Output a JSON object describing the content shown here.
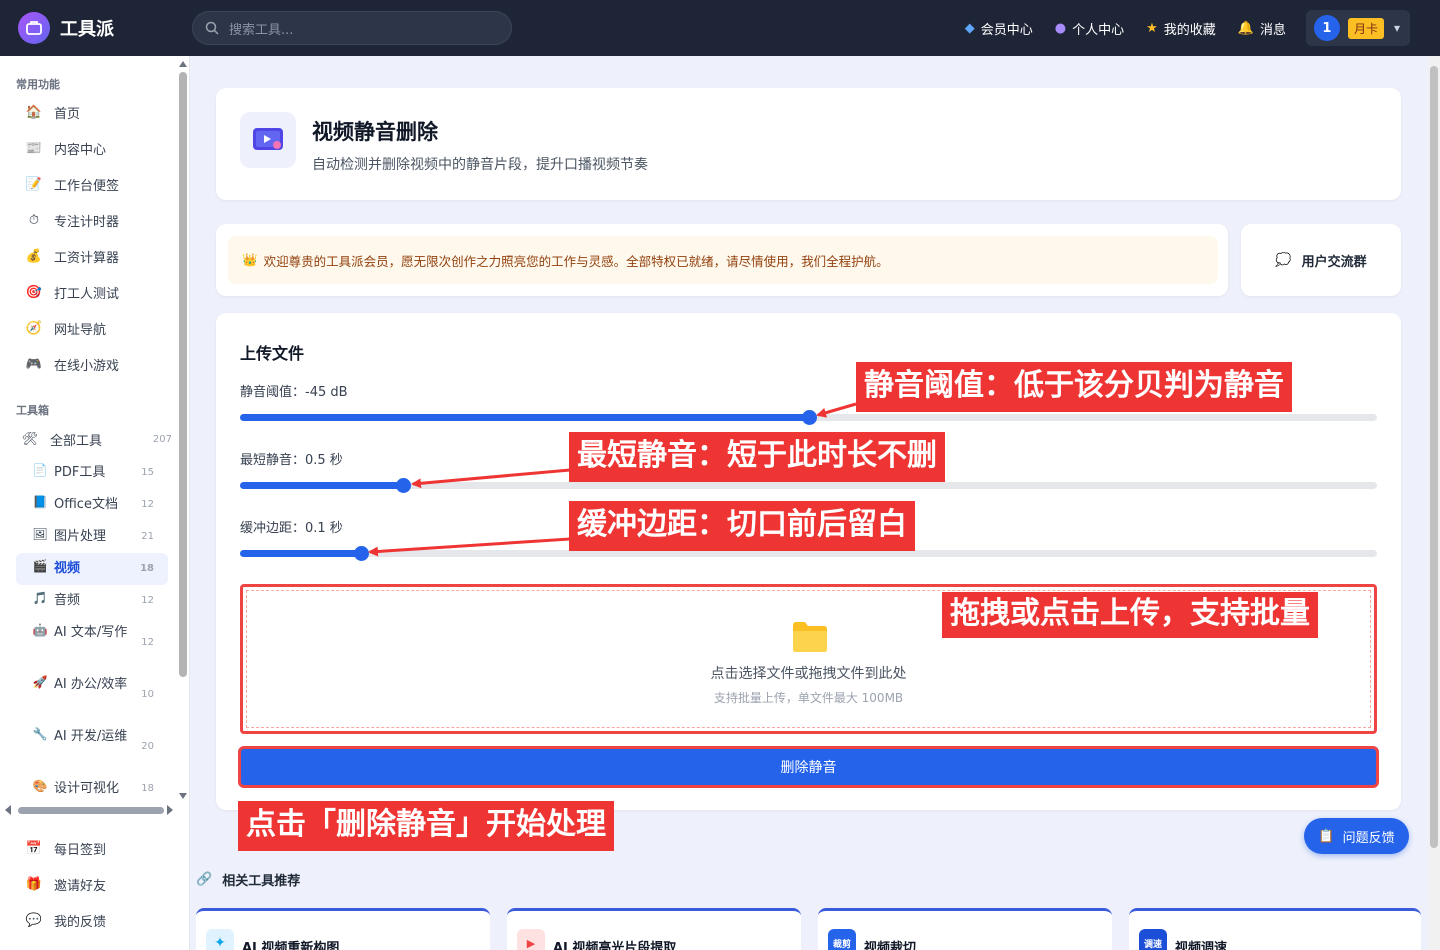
{
  "app": {
    "name": "工具派"
  },
  "search": {
    "placeholder": "搜索工具..."
  },
  "topnav": {
    "vip": "会员中心",
    "profile": "个人中心",
    "favorites": "我的收藏",
    "messages": "消息",
    "user_initial": "1",
    "membership_badge": "月卡"
  },
  "sidebar": {
    "section_common": "常用功能",
    "common_items": [
      {
        "label": "首页",
        "icon": "house-icon"
      },
      {
        "label": "内容中心",
        "icon": "newspaper-icon"
      },
      {
        "label": "工作台便签",
        "icon": "memo-icon"
      },
      {
        "label": "专注计时器",
        "icon": "stopwatch-icon"
      },
      {
        "label": "工资计算器",
        "icon": "money-bag-icon"
      },
      {
        "label": "打工人测试",
        "icon": "target-icon"
      },
      {
        "label": "网址导航",
        "icon": "compass-icon"
      },
      {
        "label": "在线小游戏",
        "icon": "gamepad-icon"
      }
    ],
    "section_tools": "工具箱",
    "all_tools": {
      "label": "全部工具",
      "count": "207"
    },
    "sub_items": [
      {
        "label": "PDF工具",
        "count": "15"
      },
      {
        "label": "Office文档",
        "count": "12"
      },
      {
        "label": "图片处理",
        "count": "21"
      },
      {
        "label": "视频",
        "count": "18"
      },
      {
        "label": "音频",
        "count": "12"
      },
      {
        "label": "AI 文本/写作",
        "count": "12"
      },
      {
        "label": "AI 办公/效率",
        "count": "10"
      },
      {
        "label": "AI 开发/运维",
        "count": "20"
      },
      {
        "label": "设计可视化",
        "count": "18"
      }
    ],
    "bottom_items": [
      {
        "label": "每日签到"
      },
      {
        "label": "邀请好友"
      },
      {
        "label": "我的反馈"
      }
    ]
  },
  "tool": {
    "title": "视频静音删除",
    "description": "自动检测并删除视频中的静音片段，提升口播视频节奏"
  },
  "welcome": {
    "message": "欢迎尊贵的工具派会员，愿无限次创作之力照亮您的工作与灵感。全部特权已就绪，请尽情使用，我们全程护航。",
    "group_label": "用户交流群"
  },
  "upload": {
    "section_title": "上传文件",
    "sliders": [
      {
        "label": "静音阈值：-45 dB",
        "fraction": 0.5
      },
      {
        "label": "最短静音：0.5 秒",
        "fraction": 0.143
      },
      {
        "label": "缓冲边距：0.1 秒",
        "fraction": 0.106
      }
    ],
    "drop_main": "点击选择文件或拖拽文件到此处",
    "drop_sub": "支持批量上传，单文件最大 100MB",
    "submit_label": "删除静音"
  },
  "annotations": {
    "threshold": "静音阈值：低于该分贝判为静音",
    "min_silence": "最短静音：短于此时长不删",
    "padding": "缓冲边距：切口前后留白",
    "drop": "拖拽或点击上传，支持批量",
    "submit": "点击「删除静音」开始处理"
  },
  "related": {
    "title": "相关工具推荐",
    "items": [
      {
        "label": "AI 视频重新构图",
        "icon_color": "#e0f2fe"
      },
      {
        "label": "AI 视频高光片段提取",
        "icon_color": "#fee2e2"
      },
      {
        "label": "视频裁切",
        "icon_text": "裁剪",
        "icon_color": "#2563eb"
      },
      {
        "label": "视频调速",
        "icon_text": "调速",
        "icon_color": "#1d4ed8"
      }
    ]
  },
  "feedback": {
    "label": "问题反馈"
  }
}
